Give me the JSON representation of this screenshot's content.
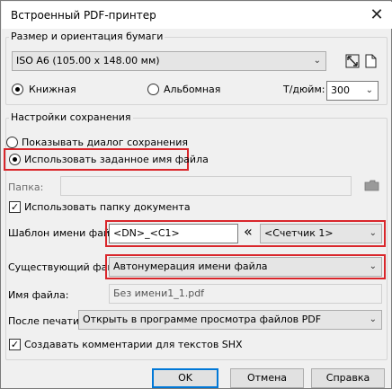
{
  "window": {
    "title": "Встроенный PDF-принтер",
    "close_glyph": "✕"
  },
  "paper": {
    "group_label": "Размер и ориентация бумаги",
    "size_value": "ISO A6 (105.00 x 148.00 мм)",
    "portrait_label": "Книжная",
    "landscape_label": "Альбомная",
    "orientation_selected": "portrait",
    "dpi_label": "Т/дюйм:",
    "dpi_value": "300"
  },
  "save": {
    "group_label": "Настройки сохранения",
    "show_dialog_label": "Показывать диалог сохранения",
    "use_name_label": "Использовать заданное имя файла",
    "folder_label": "Папка:",
    "folder_value": "",
    "use_doc_folder_label": "Использовать папку документа",
    "use_doc_folder_checked": true,
    "template_label": "Шаблон имени файла:",
    "template_value": "<DN>_<C1>",
    "insert_glyph": "«",
    "counter_value": "<Счетчик 1>",
    "existing_label": "Существующий файл:",
    "existing_value": "Автонумерация имени файла",
    "filename_label": "Имя файла:",
    "filename_value": "Без имени1_1.pdf",
    "after_print_label": "После печати:",
    "after_print_value": "Открыть в программе просмотра файлов PDF",
    "shx_label": "Создавать комментарии для текстов SHX",
    "shx_checked": true
  },
  "buttons": {
    "ok": "OK",
    "cancel": "Отмена",
    "help": "Справка"
  },
  "colors": {
    "highlight": "#d9262b",
    "default_button": "#0078d7"
  }
}
